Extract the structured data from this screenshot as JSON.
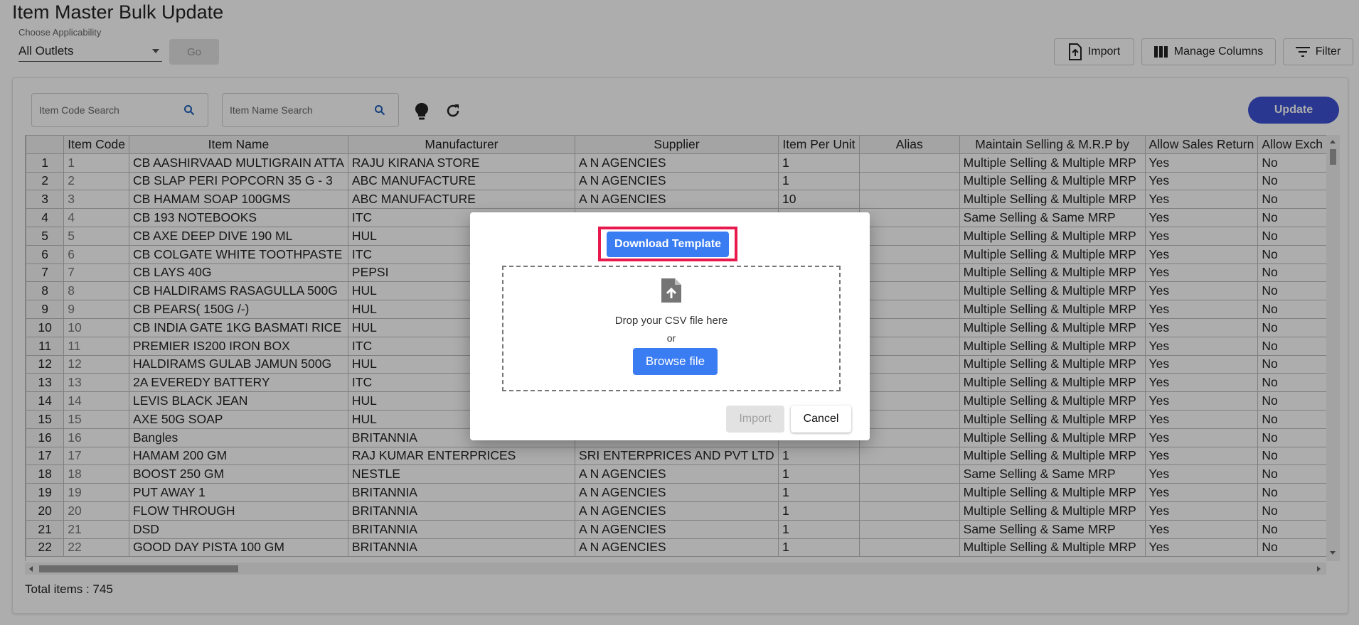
{
  "header": {
    "title": "Item Master Bulk Update",
    "choose_label": "Choose Applicability",
    "applicability_value": "All Outlets",
    "go_label": "Go",
    "import_label": "Import",
    "manage_columns_label": "Manage Columns",
    "filter_label": "Filter"
  },
  "toolbar": {
    "item_code_placeholder": "Item Code Search",
    "item_name_placeholder": "Item Name Search",
    "update_label": "Update"
  },
  "table": {
    "columns": [
      "",
      "Item Code",
      "Item Name",
      "Manufacturer",
      "Supplier",
      "Item Per Unit",
      "Alias",
      "Maintain Selling & M.R.P by",
      "Allow Sales Return",
      "Allow Exch"
    ],
    "rows": [
      [
        "1",
        "1",
        "CB AASHIRVAAD MULTIGRAIN ATTA",
        "RAJU KIRANA STORE",
        "A N AGENCIES",
        "1",
        "",
        "Multiple Selling & Multiple MRP",
        "Yes",
        "No"
      ],
      [
        "2",
        "2",
        "CB SLAP PERI POPCORN 35 G - 3",
        "ABC MANUFACTURE",
        "A N AGENCIES",
        "1",
        "",
        "Multiple Selling & Multiple MRP",
        "Yes",
        "No"
      ],
      [
        "3",
        "3",
        "CB HAMAM SOAP 100GMS",
        "ABC MANUFACTURE",
        "A N AGENCIES",
        "10",
        "",
        "Multiple Selling & Multiple MRP",
        "Yes",
        "No"
      ],
      [
        "4",
        "4",
        "CB 193 NOTEBOOKS",
        "ITC",
        "",
        "",
        "",
        "Same Selling & Same MRP",
        "Yes",
        "No"
      ],
      [
        "5",
        "5",
        "CB AXE DEEP DIVE 190 ML",
        "HUL",
        "",
        "",
        "",
        "Multiple Selling & Multiple MRP",
        "Yes",
        "No"
      ],
      [
        "6",
        "6",
        "CB COLGATE WHITE TOOTHPASTE",
        "ITC",
        "",
        "",
        "",
        "Multiple Selling & Multiple MRP",
        "Yes",
        "No"
      ],
      [
        "7",
        "7",
        "CB LAYS 40G",
        "PEPSI",
        "",
        "",
        "",
        "Multiple Selling & Multiple MRP",
        "Yes",
        "No"
      ],
      [
        "8",
        "8",
        "CB HALDIRAMS RASAGULLA 500G",
        "HUL",
        "",
        "",
        "",
        "Multiple Selling & Multiple MRP",
        "Yes",
        "No"
      ],
      [
        "9",
        "9",
        "CB PEARS( 150G /-)",
        "HUL",
        "",
        "",
        "",
        "Multiple Selling & Multiple MRP",
        "Yes",
        "No"
      ],
      [
        "10",
        "10",
        "CB INDIA GATE 1KG BASMATI RICE",
        "HUL",
        "",
        "",
        "",
        "Multiple Selling & Multiple MRP",
        "Yes",
        "No"
      ],
      [
        "11",
        "11",
        "PREMIER IS200 IRON BOX",
        "ITC",
        "",
        "",
        "",
        "Multiple Selling & Multiple MRP",
        "Yes",
        "No"
      ],
      [
        "12",
        "12",
        "HALDIRAMS GULAB JAMUN 500G",
        "HUL",
        "",
        "",
        "",
        "Multiple Selling & Multiple MRP",
        "Yes",
        "No"
      ],
      [
        "13",
        "13",
        "2A EVEREDY BATTERY",
        "ITC",
        "",
        "",
        "",
        "Multiple Selling & Multiple MRP",
        "Yes",
        "No"
      ],
      [
        "14",
        "14",
        "LEVIS BLACK JEAN",
        "HUL",
        "",
        "",
        "",
        "Multiple Selling & Multiple MRP",
        "Yes",
        "No"
      ],
      [
        "15",
        "15",
        "AXE 50G SOAP",
        "HUL",
        "",
        "",
        "",
        "Multiple Selling & Multiple MRP",
        "Yes",
        "No"
      ],
      [
        "16",
        "16",
        "Bangles",
        "BRITANNIA",
        "",
        "",
        "",
        "Multiple Selling & Multiple MRP",
        "Yes",
        "No"
      ],
      [
        "17",
        "17",
        "HAMAM 200 GM",
        "RAJ KUMAR ENTERPRICES",
        "SRI ENTERPRICES AND PVT LTD",
        "1",
        "",
        "Multiple Selling & Multiple MRP",
        "Yes",
        "No"
      ],
      [
        "18",
        "18",
        "BOOST 250 GM",
        "NESTLE",
        "A N AGENCIES",
        "1",
        "",
        "Same Selling & Same MRP",
        "Yes",
        "No"
      ],
      [
        "19",
        "19",
        "PUT AWAY 1",
        "BRITANNIA",
        "A N AGENCIES",
        "1",
        "",
        "Multiple Selling & Multiple MRP",
        "Yes",
        "No"
      ],
      [
        "20",
        "20",
        "FLOW THROUGH",
        "BRITANNIA",
        "A N AGENCIES",
        "1",
        "",
        "Multiple Selling & Multiple MRP",
        "Yes",
        "No"
      ],
      [
        "21",
        "21",
        "DSD",
        "BRITANNIA",
        "A N AGENCIES",
        "1",
        "",
        "Same Selling & Same MRP",
        "Yes",
        "No"
      ],
      [
        "22",
        "22",
        "GOOD DAY PISTA 100 GM",
        "BRITANNIA",
        "A N AGENCIES",
        "1",
        "",
        "Multiple Selling & Multiple MRP",
        "Yes",
        "No"
      ]
    ],
    "total_label": "Total items : 745"
  },
  "modal": {
    "download_template_label": "Download Template",
    "drop_text": "Drop your CSV file here",
    "or_text": "or",
    "browse_label": "Browse file",
    "import_label": "Import",
    "cancel_label": "Cancel"
  },
  "colors": {
    "primary": "#3a7cf2",
    "update": "#3d52d5",
    "highlight": "#e8194d"
  }
}
